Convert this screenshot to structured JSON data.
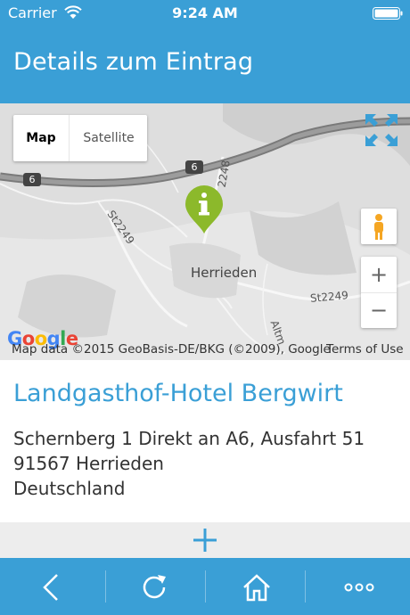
{
  "status": {
    "carrier": "Carrier",
    "time": "9:24 AM"
  },
  "header": {
    "title": "Details zum Eintrag"
  },
  "map": {
    "type_options": [
      "Map",
      "Satellite"
    ],
    "selected_type": "Map",
    "place_label": "Herrieden",
    "roads": {
      "st2249_left": "St2249",
      "st2249_right": "St2249",
      "st2248": "2248",
      "a6_a": "6",
      "a6_b": "6",
      "altmuehl": "Altm"
    },
    "marker_icon": "info-marker-icon",
    "zoom_in": "+",
    "zoom_out": "−",
    "google_logo": "Google",
    "attribution": "Map data ©2015 GeoBasis-DE/BKG (©2009), Google",
    "terms": "Terms of Use"
  },
  "entry": {
    "name": "Landgasthof-Hotel Bergwirt",
    "address_lines": [
      "Schernberg 1 Direkt an A6, Ausfahrt 51",
      "91567 Herrieden",
      "Deutschland"
    ]
  },
  "toolbar": {
    "icons": [
      "back-icon",
      "reload-icon",
      "home-icon",
      "more-icon"
    ]
  },
  "colors": {
    "accent": "#3a9fd6",
    "marker": "#8cb92b",
    "add_bar": "#ededed"
  }
}
